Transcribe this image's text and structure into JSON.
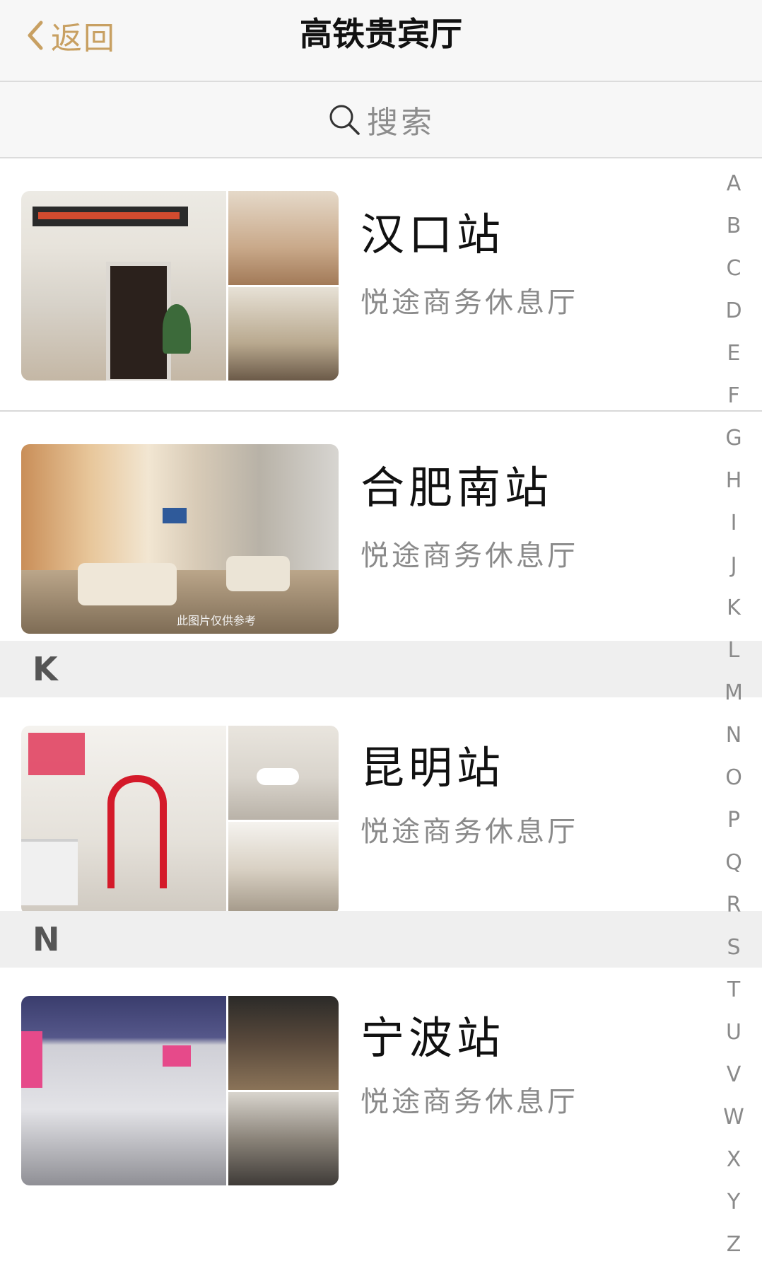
{
  "nav": {
    "back_label": "返回",
    "title": "高铁贵宾厅"
  },
  "search": {
    "placeholder": "搜索"
  },
  "items": [
    {
      "name": "汉口站",
      "subtitle": "悦途商务休息厅"
    },
    {
      "name": "合肥南站",
      "subtitle": "悦途商务休息厅",
      "watermark": "此图片仅供参考"
    },
    {
      "name": "昆明站",
      "subtitle": "悦途商务休息厅"
    },
    {
      "name": "宁波站",
      "subtitle": "悦途商务休息厅"
    }
  ],
  "sections": [
    "K",
    "N"
  ],
  "index_letters": [
    "A",
    "B",
    "C",
    "D",
    "E",
    "F",
    "G",
    "H",
    "I",
    "J",
    "K",
    "L",
    "M",
    "N",
    "O",
    "P",
    "Q",
    "R",
    "S",
    "T",
    "U",
    "V",
    "W",
    "X",
    "Y",
    "Z"
  ],
  "colors": {
    "accent": "#c8a062",
    "section_bg": "#efefef",
    "nav_bg": "#f7f7f7"
  },
  "icons": {
    "back": "chevron-left-icon",
    "search": "magnifier-icon"
  }
}
